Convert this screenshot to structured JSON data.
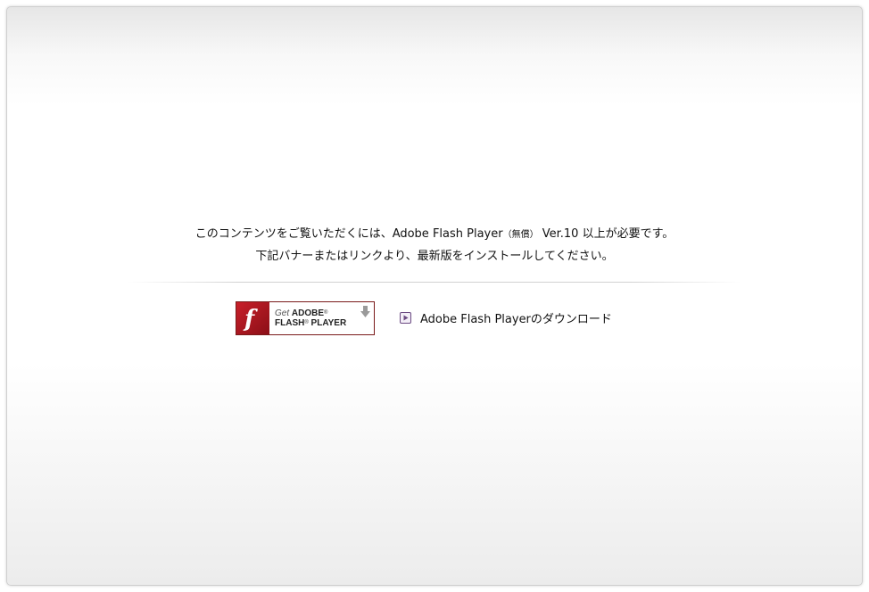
{
  "message": {
    "line1_part1": "このコンテンツをご覧いただくには、Adobe Flash Player",
    "line1_free": "（無償）",
    "line1_part2": "Ver.10 以上が必要です。",
    "line2": "下記バナーまたはリンクより、最新版をインストールしてください。"
  },
  "banner": {
    "get_label": "Get",
    "adobe_label": "ADOBE",
    "flash_label": "FLASH",
    "player_label": "PLAYER",
    "reg_mark": "®",
    "logo_letter": "f"
  },
  "download_link": {
    "label": "Adobe Flash Playerのダウンロード",
    "icon": "play-square-icon"
  },
  "colors": {
    "flash_red": "#b5161f",
    "icon_purple": "#6b4a82"
  }
}
